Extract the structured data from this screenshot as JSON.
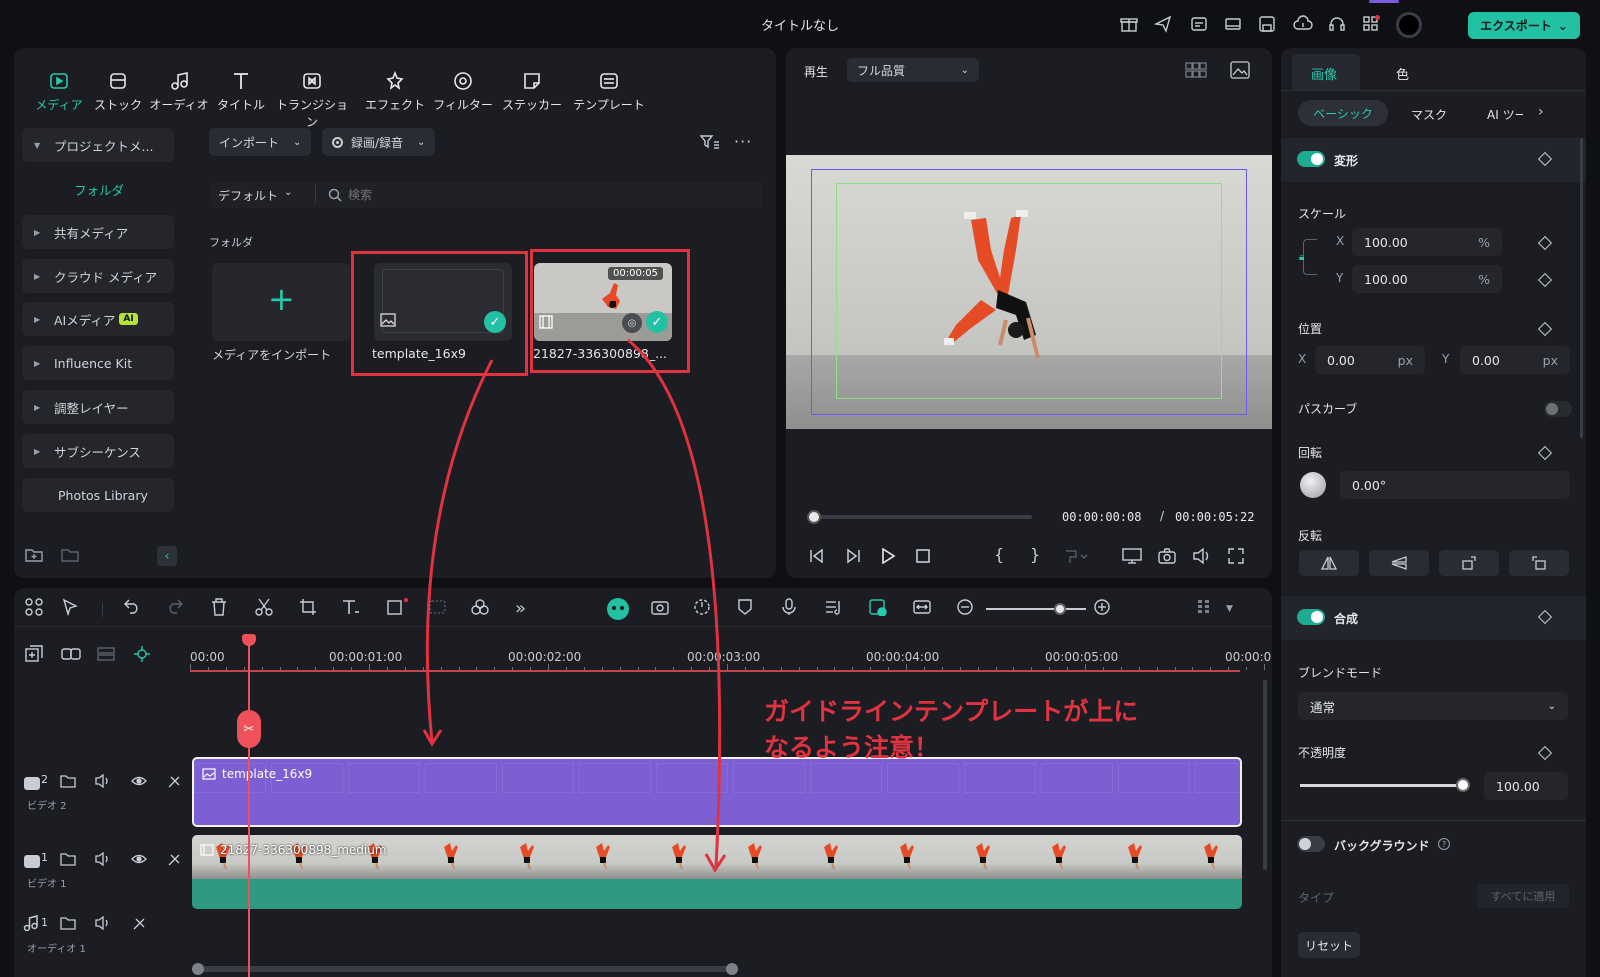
{
  "app": {
    "title": "タイトルなし",
    "export_label": "エクスポート"
  },
  "media_tabs": [
    {
      "label": "メディア",
      "icon": "media-icon"
    },
    {
      "label": "ストック",
      "icon": "stock-icon"
    },
    {
      "label": "オーディオ",
      "icon": "audio-icon"
    },
    {
      "label": "タイトル",
      "icon": "title-icon"
    },
    {
      "label": "トランジション",
      "icon": "transition-icon"
    },
    {
      "label": "エフェクト",
      "icon": "effect-icon"
    },
    {
      "label": "フィルター",
      "icon": "filter-icon"
    },
    {
      "label": "ステッカー",
      "icon": "sticker-icon"
    },
    {
      "label": "テンプレート",
      "icon": "template-icon"
    }
  ],
  "sidebar": {
    "project_media": "プロジェクトメ...",
    "folder": "フォルダ",
    "items": [
      "共有メディア",
      "クラウド メディア",
      "AIメディア",
      "Influence Kit",
      "調整レイヤー",
      "サブシーケンス",
      "Photos Library"
    ],
    "ai_badge": "AI"
  },
  "media_toolbar": {
    "import": "インポート",
    "record": "録画/録音",
    "sort": "デフォルト",
    "search_placeholder": "検索"
  },
  "media_grid": {
    "folder_label": "フォルダ",
    "import_label": "メディアをインポート",
    "items": [
      {
        "name": "template_16x9"
      },
      {
        "name": "21827-336300898_...",
        "duration": "00:00:05"
      }
    ]
  },
  "player": {
    "play_label": "再生",
    "quality": "フル品質",
    "current_time": "00:00:00:08",
    "separator": "/",
    "total_time": "00:00:05:22",
    "progress": 0.02
  },
  "timeline": {
    "ruler": [
      "00:00",
      "00:00:01:00",
      "00:00:02:00",
      "00:00:03:00",
      "00:00:04:00",
      "00:00:05:00",
      "00:00:0"
    ],
    "annotation": [
      "ガイドラインテンプレートが上に",
      "なるよう注意！"
    ],
    "tracks": [
      {
        "num": "2",
        "name": "ビデオ 2",
        "clip": "template_16x9"
      },
      {
        "num": "1",
        "name": "ビデオ 1",
        "clip": "21827-336300898_medium"
      },
      {
        "num": "1",
        "name": "オーディオ 1"
      }
    ]
  },
  "props": {
    "tabs": [
      "画像",
      "色"
    ],
    "subtabs": [
      "ベーシック",
      "マスク",
      "AI ツー"
    ],
    "transform": "変形",
    "scale": "スケール",
    "scale_x_label": "X",
    "scale_x": "100.00",
    "scale_y_label": "Y",
    "scale_y": "100.00",
    "percent": "%",
    "position": "位置",
    "pos_x_label": "X",
    "pos_x": "0.00",
    "pos_y_label": "Y",
    "pos_y": "0.00",
    "px": "px",
    "path_curve": "パスカーブ",
    "rotation": "回転",
    "rotation_value": "0.00°",
    "flip": "反転",
    "composite": "合成",
    "blend_mode": "ブレンドモード",
    "blend_value": "通常",
    "opacity": "不透明度",
    "opacity_value": "100.00",
    "background": "バックグラウンド",
    "type": "タイプ",
    "apply_all": "すべてに適用",
    "reset": "リセット"
  },
  "colors": {
    "accent": "#23c1a4",
    "purple_clip": "#7d5fd3",
    "teal_clip": "#2f9a82",
    "annotation_red": "#e0323f",
    "playhead": "#f0505a"
  }
}
